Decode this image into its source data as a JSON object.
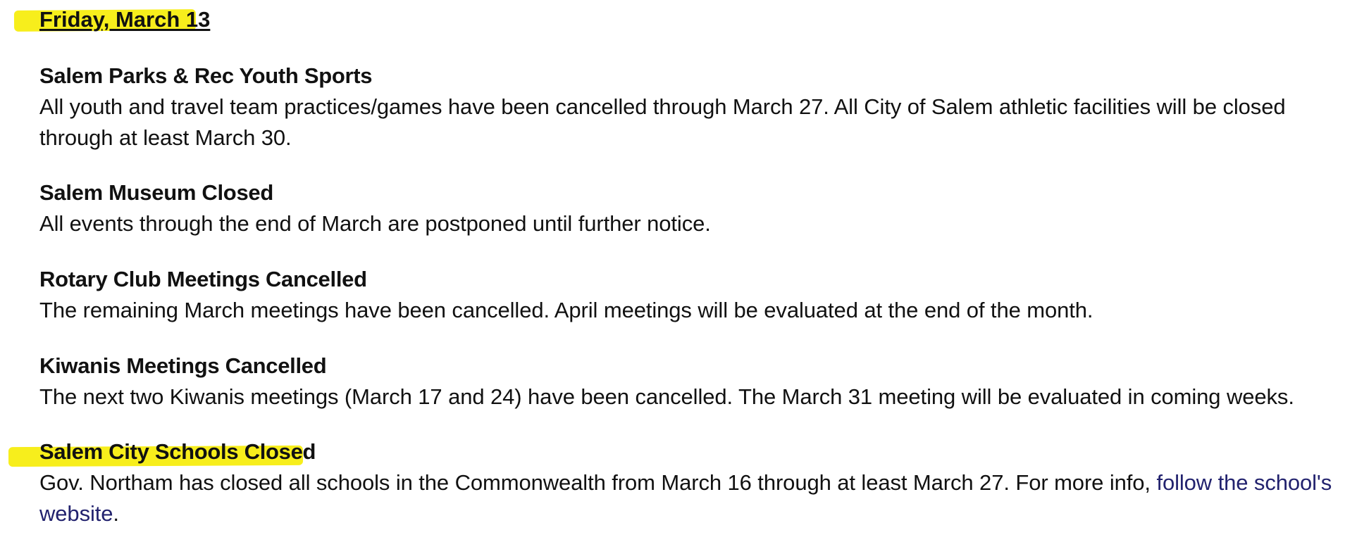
{
  "date_heading": "Friday, March 13",
  "highlight_color": "#f7ee1c",
  "link_color": "#22226e",
  "entries": [
    {
      "title": "Salem Parks & Rec Youth Sports",
      "body": "All youth and travel team practices/games have been cancelled through March 27.  All City of Salem athletic facilities will be closed through at least March 30."
    },
    {
      "title": "Salem Museum Closed",
      "body": "All events through the end of March are postponed until further notice."
    },
    {
      "title": "Rotary Club Meetings Cancelled",
      "body": "The remaining March meetings have been cancelled. April meetings will be evaluated at the end of the month."
    },
    {
      "title": "Kiwanis Meetings Cancelled",
      "body": "The next two Kiwanis meetings (March 17 and 24) have been cancelled. The March 31 meeting will be evaluated in coming weeks."
    },
    {
      "title": "Salem City Schools Closed",
      "body": "Gov. Northam has closed all schools in the Commonwealth from March 16 through at least March 27. For more info, ",
      "link_text": "follow the school's website",
      "body_end": "."
    }
  ]
}
